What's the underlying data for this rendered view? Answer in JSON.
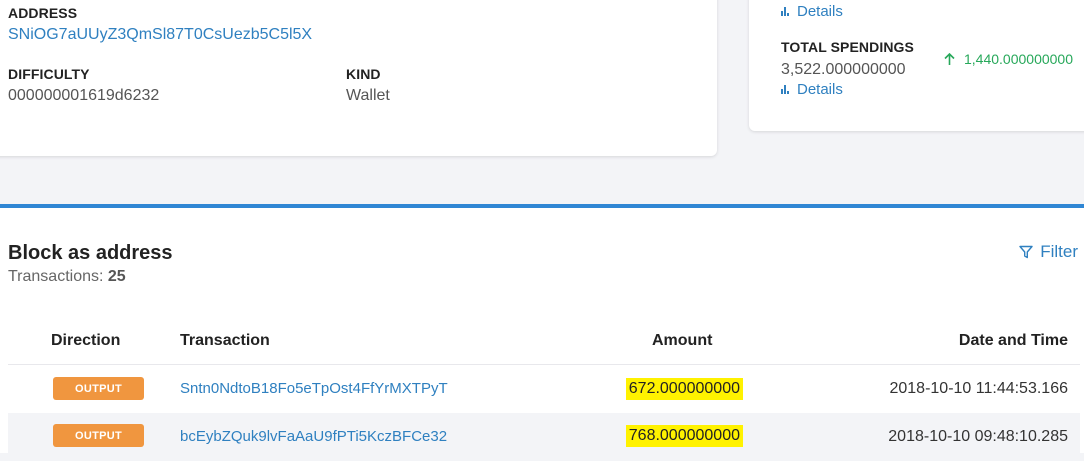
{
  "address": {
    "label": "ADDRESS",
    "value": "SNiOG7aUUyZ3QmSl87T0CsUezb5C5l5X"
  },
  "difficulty": {
    "label": "DIFFICULTY",
    "value": "000000001619d6232"
  },
  "kind": {
    "label": "KIND",
    "value": "Wallet"
  },
  "summary": {
    "details_label": "Details",
    "total_spendings": {
      "label": "TOTAL SPENDINGS",
      "value": "3,522.000000000",
      "change": "1,440.000000000"
    },
    "colors": {
      "positive": "#27a85a",
      "link": "#2f80c0"
    }
  },
  "transactions_section": {
    "title": "Block as address",
    "count_label": "Transactions:",
    "count": "25",
    "filter_label": "Filter",
    "columns": [
      "Direction",
      "Transaction",
      "Amount",
      "Date and Time"
    ],
    "rows": [
      {
        "direction": "OUTPUT",
        "tx": "Sntn0NdtoB18Fo5eTpOst4FfYrMXTPyT",
        "amount": "672.000000000",
        "datetime": "2018-10-10 11:44:53.166"
      },
      {
        "direction": "OUTPUT",
        "tx": "bcEybZQuk9lvFaAaU9fPTi5KczBFCe32",
        "amount": "768.000000000",
        "datetime": "2018-10-10 09:48:10.285"
      }
    ]
  }
}
